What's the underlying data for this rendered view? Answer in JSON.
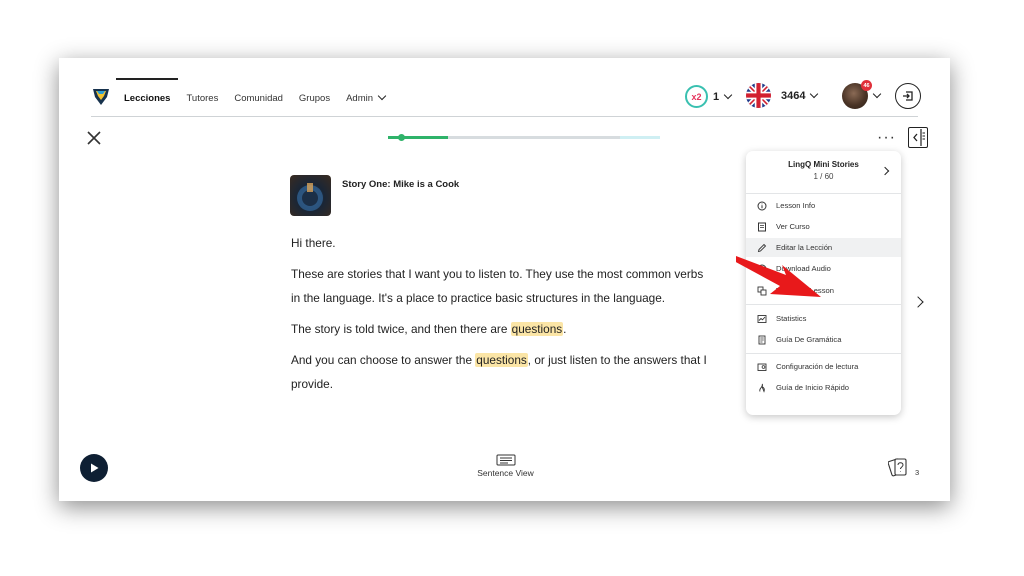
{
  "nav": {
    "links": [
      {
        "label": "Lecciones"
      },
      {
        "label": "Tutores"
      },
      {
        "label": "Comunidad"
      },
      {
        "label": "Grupos"
      },
      {
        "label": "Admin"
      }
    ],
    "streak_multiplier": "x2",
    "streak_count": "1",
    "lingq_count": "3464",
    "notification_count": "46"
  },
  "lesson": {
    "title": "Story One: Mike is a Cook",
    "progress_fraction": 0.22,
    "paragraphs": {
      "p1": "Hi there.",
      "p2": "These are stories that I want you to listen to. They use the most common verbs in the language. It's a place to practice basic structures in the language.",
      "p3_before": "The story is told twice, and then there are ",
      "p3_highlight": "questions",
      "p3_after": ".",
      "p4_before": "And you can choose to answer the ",
      "p4_highlight": "questions",
      "p4_after": ", or just listen to the answers that I provide."
    }
  },
  "menu": {
    "course_title": "LingQ Mini Stories",
    "course_count": "1 / 60",
    "items": [
      {
        "label": "Lesson Info",
        "icon": "info-icon"
      },
      {
        "label": "Ver Curso",
        "icon": "course-icon"
      },
      {
        "label": "Editar la Lección",
        "icon": "pencil-icon"
      },
      {
        "label": "Download Audio",
        "icon": "download-icon"
      },
      {
        "label": "Translate Lesson",
        "icon": "translate-icon"
      },
      {
        "label": "Statistics",
        "icon": "statistics-icon"
      },
      {
        "label": "Guía De Gramática",
        "icon": "grammar-guide-icon"
      },
      {
        "label": "Configuración de lectura",
        "icon": "reading-settings-icon"
      },
      {
        "label": "Guía de Inicio Rápido",
        "icon": "quick-start-icon"
      }
    ]
  },
  "bottom": {
    "sentence_view_label": "Sentence View",
    "cards_count": "3"
  },
  "colors": {
    "progress_green": "#2fb36a",
    "highlight_yellow": "#fbe5a6",
    "play_button": "#0e1f33",
    "annotation_arrow": "#e8191b"
  }
}
